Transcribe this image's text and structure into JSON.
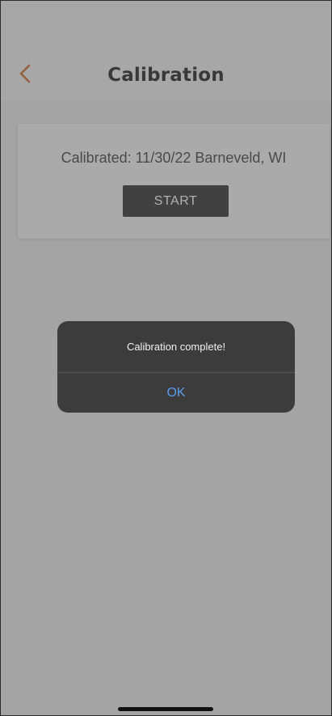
{
  "header": {
    "back_icon": "chevron-left-icon",
    "title": "Calibration"
  },
  "card": {
    "calibrated_text": "Calibrated: 11/30/22 Barneveld, WI",
    "start_label": "START"
  },
  "alert": {
    "message": "Calibration complete!",
    "ok_label": "OK"
  },
  "colors": {
    "accent_back": "#c8611e",
    "alert_button": "#5b9bea",
    "start_button_bg": "#222222"
  }
}
